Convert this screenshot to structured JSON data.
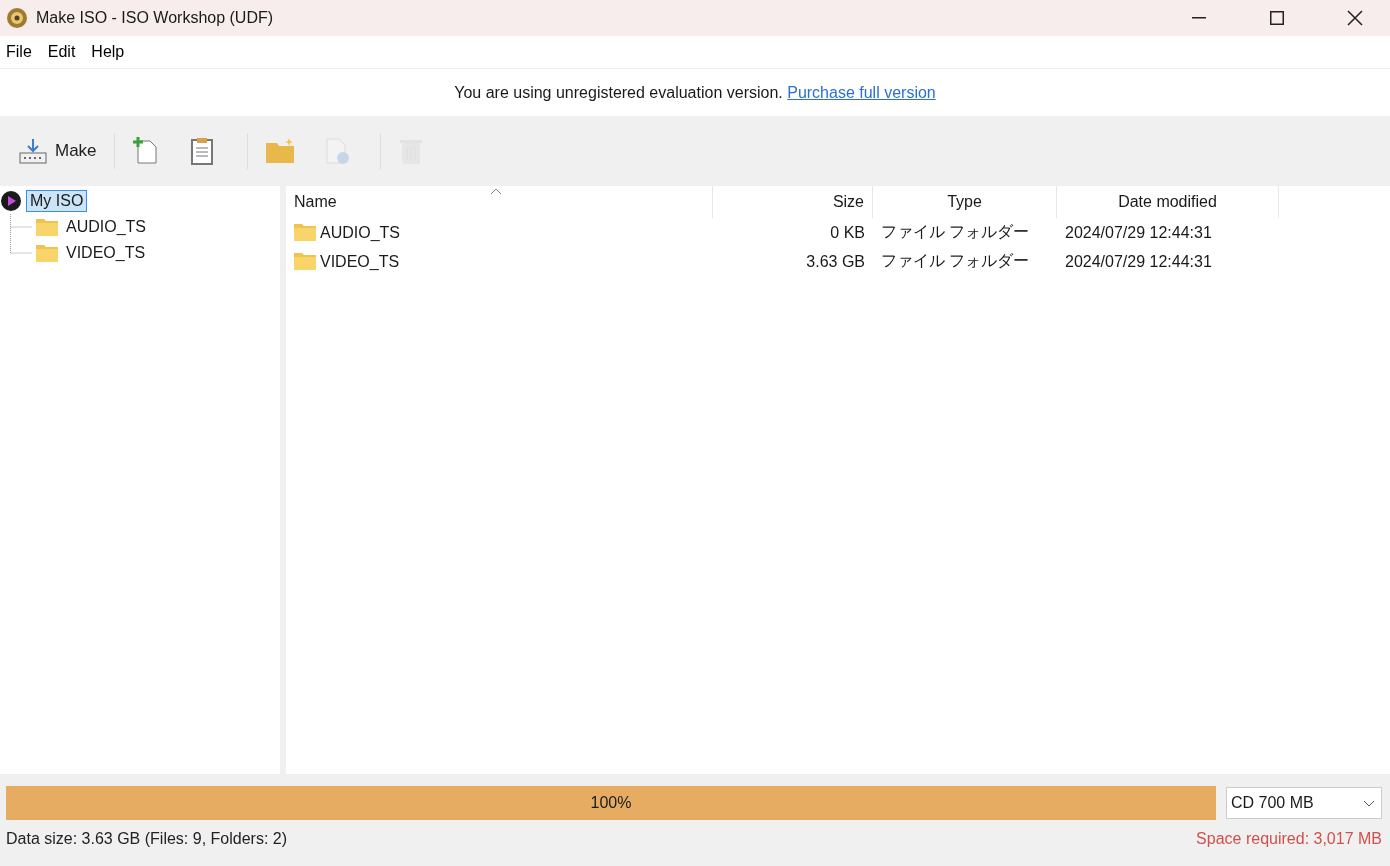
{
  "window": {
    "title": "Make ISO - ISO Workshop (UDF)"
  },
  "menu": [
    "File",
    "Edit",
    "Help"
  ],
  "banner": {
    "text": "You are using unregistered evaluation version.",
    "link": "Purchase full version"
  },
  "toolbar": [
    {
      "kind": "make",
      "label": "Make",
      "disabled": false
    },
    {
      "kind": "add-file",
      "disabled": false
    },
    {
      "kind": "clipboard",
      "disabled": false
    },
    {
      "kind": "new-folder",
      "disabled": false
    },
    {
      "kind": "file-info",
      "disabled": true
    },
    {
      "kind": "delete",
      "disabled": true
    }
  ],
  "tree": {
    "label": "My ISO",
    "selected": true,
    "children": [
      {
        "label": "AUDIO_TS",
        "selected": false
      },
      {
        "label": "VIDEO_TS",
        "selected": false
      }
    ]
  },
  "table": {
    "columns": [
      "Name",
      "Size",
      "Type",
      "Date modified"
    ],
    "rows": [
      [
        "AUDIO_TS",
        "0 KB",
        "ファイル フォルダー",
        "2024/07/29 12:44:31"
      ],
      [
        "VIDEO_TS",
        "3.63 GB",
        "ファイル フォルダー",
        "2024/07/29 12:44:31"
      ]
    ]
  },
  "progress": {
    "level": 1.0,
    "reading": "100%"
  },
  "media": {
    "value": "CD 700 MB"
  },
  "status_bar": {
    "left": "Data size: 3.63 GB (Files: 9, Folders: 2)",
    "right": "Space required: 3,017 MB"
  }
}
